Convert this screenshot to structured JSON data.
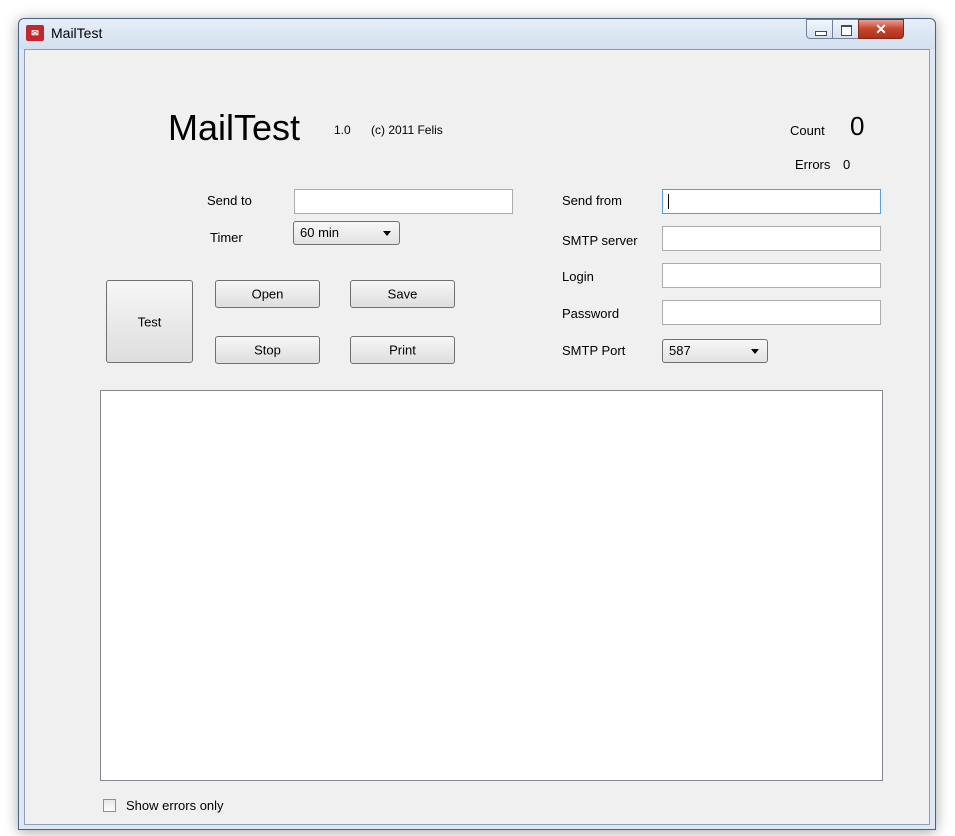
{
  "window": {
    "title": "MailTest",
    "icon": "app-envelope-icon"
  },
  "header": {
    "app_name": "MailTest",
    "version": "1.0",
    "copyright": "(c) 2011 Felis",
    "count_label": "Count",
    "count_value": "0",
    "errors_label": "Errors",
    "errors_value": "0"
  },
  "form": {
    "send_to_label": "Send to",
    "send_to_value": "",
    "timer_label": "Timer",
    "timer_value": "60 min",
    "send_from_label": "Send from",
    "send_from_value": "",
    "smtp_server_label": "SMTP server",
    "smtp_server_value": "",
    "login_label": "Login",
    "login_value": "",
    "password_label": "Password",
    "password_value": "",
    "smtp_port_label": "SMTP Port",
    "smtp_port_value": "587"
  },
  "buttons": {
    "test": "Test",
    "open": "Open",
    "save": "Save",
    "stop": "Stop",
    "print": "Print"
  },
  "footer": {
    "show_errors_only_label": "Show errors only",
    "show_errors_only_checked": false
  },
  "colors": {
    "window_frame": "#dde8f4",
    "client_bg": "#f0f0f0",
    "close_button": "#c4442d",
    "app_icon": "#c1272d"
  }
}
